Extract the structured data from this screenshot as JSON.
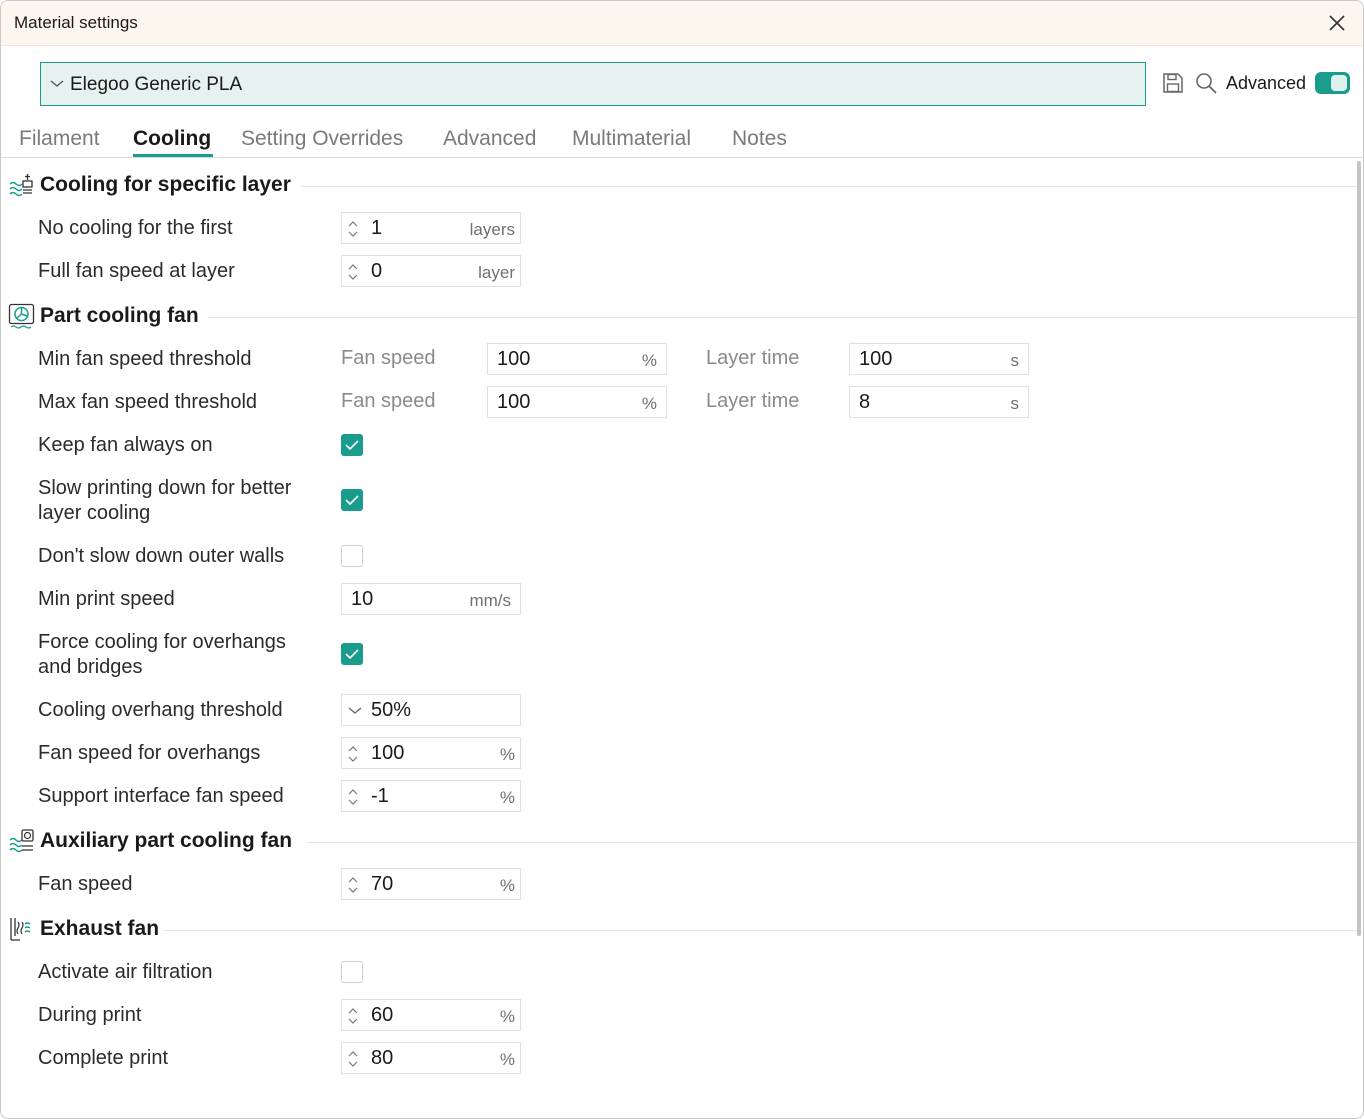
{
  "window": {
    "title": "Material settings"
  },
  "preset": {
    "value": "Elegoo Generic PLA"
  },
  "toolbar": {
    "advanced_label": "Advanced",
    "advanced_on": true
  },
  "tabs": [
    {
      "label": "Filament",
      "active": false
    },
    {
      "label": "Cooling",
      "active": true
    },
    {
      "label": "Setting Overrides",
      "active": false
    },
    {
      "label": "Advanced",
      "active": false
    },
    {
      "label": "Multimaterial",
      "active": false
    },
    {
      "label": "Notes",
      "active": false
    }
  ],
  "sections": {
    "specific_layer": {
      "title": "Cooling for specific layer",
      "no_cooling": {
        "label": "No cooling for the first",
        "value": "1",
        "unit": "layers"
      },
      "full_fan": {
        "label": "Full fan speed at layer",
        "value": "0",
        "unit": "layer"
      }
    },
    "part_fan": {
      "title": "Part cooling fan",
      "min_thresh": {
        "label": "Min fan speed threshold",
        "fan_label": "Fan speed",
        "fan_value": "100",
        "fan_unit": "%",
        "time_label": "Layer time",
        "time_value": "100",
        "time_unit": "s"
      },
      "max_thresh": {
        "label": "Max fan speed threshold",
        "fan_label": "Fan speed",
        "fan_value": "100",
        "fan_unit": "%",
        "time_label": "Layer time",
        "time_value": "8",
        "time_unit": "s"
      },
      "keep_fan": {
        "label": "Keep fan always on",
        "checked": true
      },
      "slow_down": {
        "label_line1": "Slow printing down for better",
        "label_line2": "layer cooling",
        "checked": true
      },
      "dont_slow": {
        "label": "Don't slow down outer walls",
        "checked": false
      },
      "min_speed": {
        "label": "Min print speed",
        "value": "10",
        "unit": "mm/s"
      },
      "force_cooling": {
        "label_line1": "Force cooling for overhangs",
        "label_line2": "and bridges",
        "checked": true
      },
      "overhang_thresh": {
        "label": "Cooling overhang threshold",
        "value": "50%"
      },
      "overhang_fan": {
        "label": "Fan speed for overhangs",
        "value": "100",
        "unit": "%"
      },
      "support_fan": {
        "label": "Support interface fan speed",
        "value": "-1",
        "unit": "%"
      }
    },
    "aux_fan": {
      "title": "Auxiliary part cooling fan",
      "fan_speed": {
        "label": "Fan speed",
        "value": "70",
        "unit": "%"
      }
    },
    "exhaust": {
      "title": "Exhaust fan",
      "activate": {
        "label": "Activate air filtration",
        "checked": false
      },
      "during": {
        "label": "During print",
        "value": "60",
        "unit": "%"
      },
      "complete": {
        "label": "Complete print",
        "value": "80",
        "unit": "%"
      }
    }
  },
  "colors": {
    "accent": "#1a9c8c",
    "title_bg": "#fbf6ee",
    "combo_bg": "#e6f2ef"
  },
  "icons": [
    "close-icon",
    "chevron-down-icon",
    "save-icon",
    "search-icon",
    "layer-cooling-icon",
    "fan-icon",
    "aux-fan-icon",
    "exhaust-fan-icon",
    "spin-arrows-icon",
    "check-icon"
  ]
}
